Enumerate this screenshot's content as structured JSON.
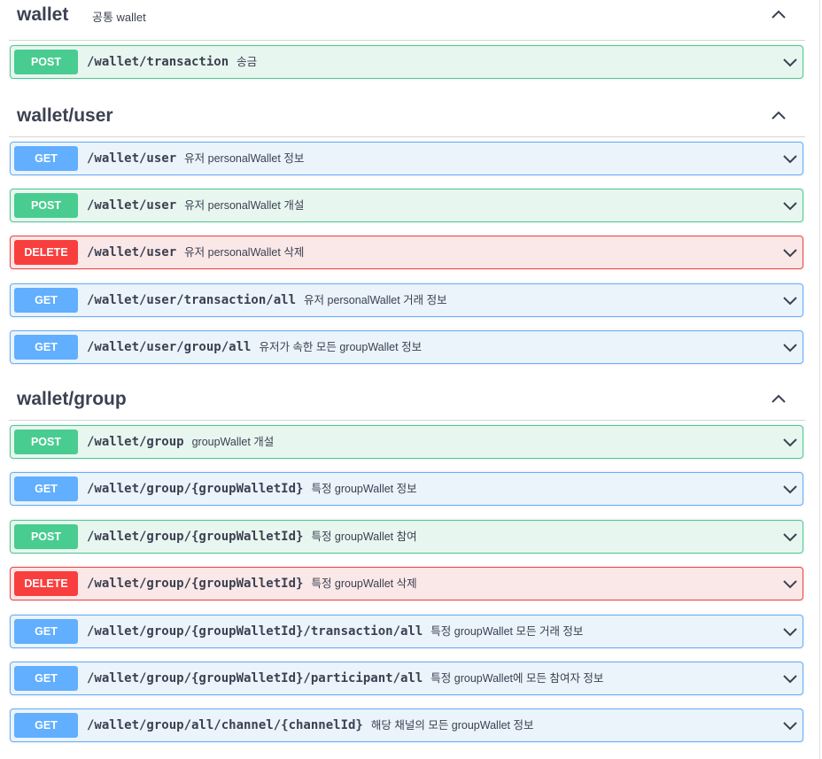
{
  "sections": [
    {
      "name": "wallet",
      "description": "공통 wallet",
      "operations": [
        {
          "method": "POST",
          "path": "/wallet/transaction",
          "summary": "송금"
        }
      ]
    },
    {
      "name": "wallet/user",
      "description": "",
      "operations": [
        {
          "method": "GET",
          "path": "/wallet/user",
          "summary": "유저 personalWallet 정보"
        },
        {
          "method": "POST",
          "path": "/wallet/user",
          "summary": "유저 personalWallet 개설"
        },
        {
          "method": "DELETE",
          "path": "/wallet/user",
          "summary": "유저 personalWallet 삭제"
        },
        {
          "method": "GET",
          "path": "/wallet/user/transaction/all",
          "summary": "유저 personalWallet 거래 정보"
        },
        {
          "method": "GET",
          "path": "/wallet/user/group/all",
          "summary": "유저가 속한 모든 groupWallet 정보"
        }
      ]
    },
    {
      "name": "wallet/group",
      "description": "",
      "operations": [
        {
          "method": "POST",
          "path": "/wallet/group",
          "summary": "groupWallet 개설"
        },
        {
          "method": "GET",
          "path": "/wallet/group/{groupWalletId}",
          "summary": "특정 groupWallet 정보"
        },
        {
          "method": "POST",
          "path": "/wallet/group/{groupWalletId}",
          "summary": "특정 groupWallet 참여"
        },
        {
          "method": "DELETE",
          "path": "/wallet/group/{groupWalletId}",
          "summary": "특정 groupWallet 삭제"
        },
        {
          "method": "GET",
          "path": "/wallet/group/{groupWalletId}/transaction/all",
          "summary": "특정 groupWallet 모든 거래 정보"
        },
        {
          "method": "GET",
          "path": "/wallet/group/{groupWalletId}/participant/all",
          "summary": "특정 groupWallet에 모든 참여자 정보"
        },
        {
          "method": "GET",
          "path": "/wallet/group/all/channel/{channelId}",
          "summary": "해당 채널의 모든 groupWallet 정보"
        }
      ]
    }
  ],
  "colors": {
    "get": "#61affe",
    "post": "#49cc90",
    "delete": "#f93e3e",
    "get_bg": "#ebf3fb",
    "post_bg": "#e8f6f0",
    "delete_bg": "#fae7e7",
    "text": "#3b4151"
  },
  "icons": {
    "tag_toggle": "chevron-up-icon",
    "op_toggle": "chevron-down-icon"
  }
}
